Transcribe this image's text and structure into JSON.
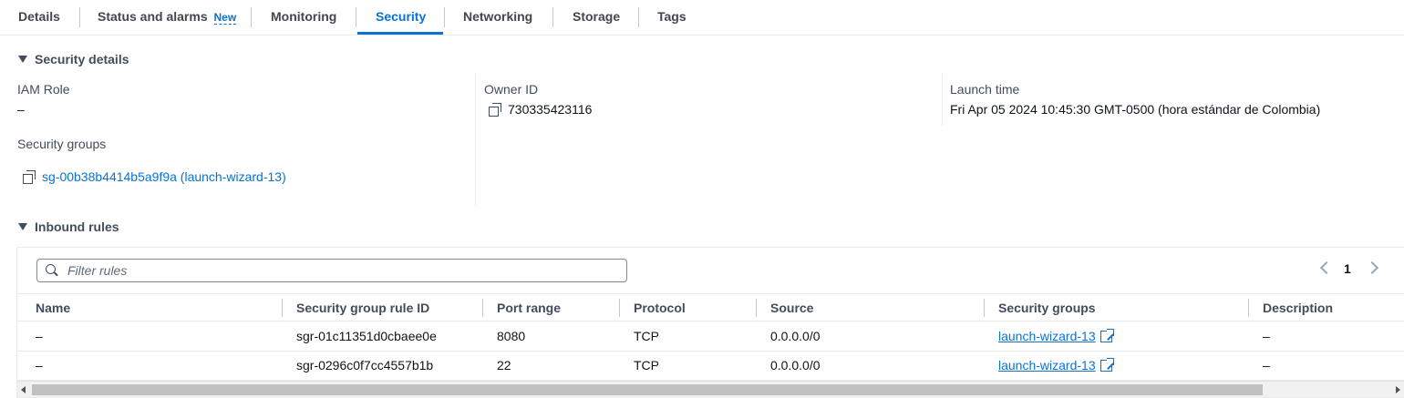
{
  "tabs": [
    {
      "label": "Details"
    },
    {
      "label": "Status and alarms",
      "badge": "New"
    },
    {
      "label": "Monitoring"
    },
    {
      "label": "Security",
      "active": true
    },
    {
      "label": "Networking"
    },
    {
      "label": "Storage"
    },
    {
      "label": "Tags"
    }
  ],
  "security_details": {
    "header": "Security details",
    "iam_role_label": "IAM Role",
    "iam_role_value": "–",
    "owner_id_label": "Owner ID",
    "owner_id_value": "730335423116",
    "launch_time_label": "Launch time",
    "launch_time_value": "Fri Apr 05 2024 10:45:30 GMT-0500 (hora estándar de Colombia)",
    "security_groups_label": "Security groups",
    "security_groups_value": "sg-00b38b4414b5a9f9a (launch-wizard-13)"
  },
  "inbound_rules": {
    "header": "Inbound rules",
    "filter_placeholder": "Filter rules",
    "current_page": "1",
    "columns": [
      "Name",
      "Security group rule ID",
      "Port range",
      "Protocol",
      "Source",
      "Security groups",
      "Description"
    ],
    "rows": [
      {
        "name": "–",
        "rule_id": "sgr-01c11351d0cbaee0e",
        "port_range": "8080",
        "protocol": "TCP",
        "source": "0.0.0.0/0",
        "security_group": "launch-wizard-13",
        "description": "–"
      },
      {
        "name": "–",
        "rule_id": "sgr-0296c0f7cc4557b1b",
        "port_range": "22",
        "protocol": "TCP",
        "source": "0.0.0.0/0",
        "security_group": "launch-wizard-13",
        "description": "–"
      }
    ]
  },
  "colors": {
    "accent": "#0972d3",
    "text": "#0f141a",
    "label": "#414d5c"
  }
}
